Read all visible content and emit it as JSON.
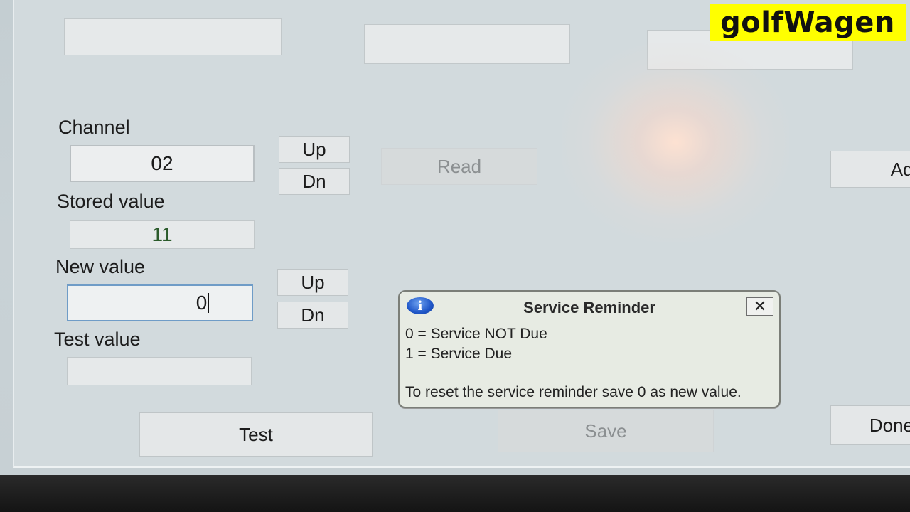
{
  "channel": {
    "label": "Channel",
    "value": "02",
    "up": "Up",
    "dn": "Dn"
  },
  "read_button": "Read",
  "stored_value": {
    "label": "Stored value",
    "value": "11"
  },
  "new_value": {
    "label": "New value",
    "value": "0",
    "up": "Up",
    "dn": "Dn"
  },
  "test_value": {
    "label": "Test value",
    "value": ""
  },
  "buttons": {
    "test": "Test",
    "save": "Save",
    "done": "Done",
    "add": "Add"
  },
  "dialog": {
    "title": "Service Reminder",
    "icon": "info-icon",
    "close": "✕",
    "lines": [
      "0 = Service NOT Due",
      "1 = Service Due",
      "To reset the service reminder save 0 as new value."
    ]
  },
  "watermark": "golfWagen",
  "colors": {
    "accent": "#6f9cc7",
    "watermark_bg": "#ffff00"
  }
}
